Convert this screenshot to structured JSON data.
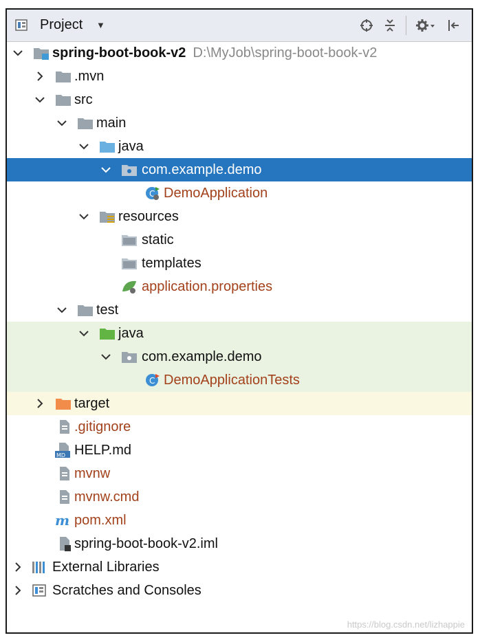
{
  "header": {
    "title": "Project",
    "caret": "▼",
    "icons": [
      "project-icon",
      "locate-icon",
      "collapse-all-icon",
      "gear-icon",
      "hide-panel-icon"
    ]
  },
  "tree": {
    "root": {
      "name": "spring-boot-book-v2",
      "path": "D:\\MyJob\\spring-boot-book-v2"
    },
    "mvn": ".mvn",
    "src": "src",
    "main": "main",
    "main_java": "java",
    "main_pkg": "com.example.demo",
    "demo_app": "DemoApplication",
    "resources": "resources",
    "static": "static",
    "templates": "templates",
    "app_props": "application.properties",
    "test": "test",
    "test_java": "java",
    "test_pkg": "com.example.demo",
    "demo_tests": "DemoApplicationTests",
    "target": "target",
    "gitignore": ".gitignore",
    "help": "HELP.md",
    "mvnw": "mvnw",
    "mvnw_cmd": "mvnw.cmd",
    "pom": "pom.xml",
    "iml": "spring-boot-book-v2.iml",
    "ext_libs": "External Libraries",
    "scratches": "Scratches and Consoles"
  },
  "colors": {
    "selection": "#2675bf",
    "test_bg": "#eaf3e2",
    "target_bg": "#fbf8e1",
    "modified_text": "#a2411b"
  },
  "watermark": "https://blog.csdn.net/lizhappie"
}
